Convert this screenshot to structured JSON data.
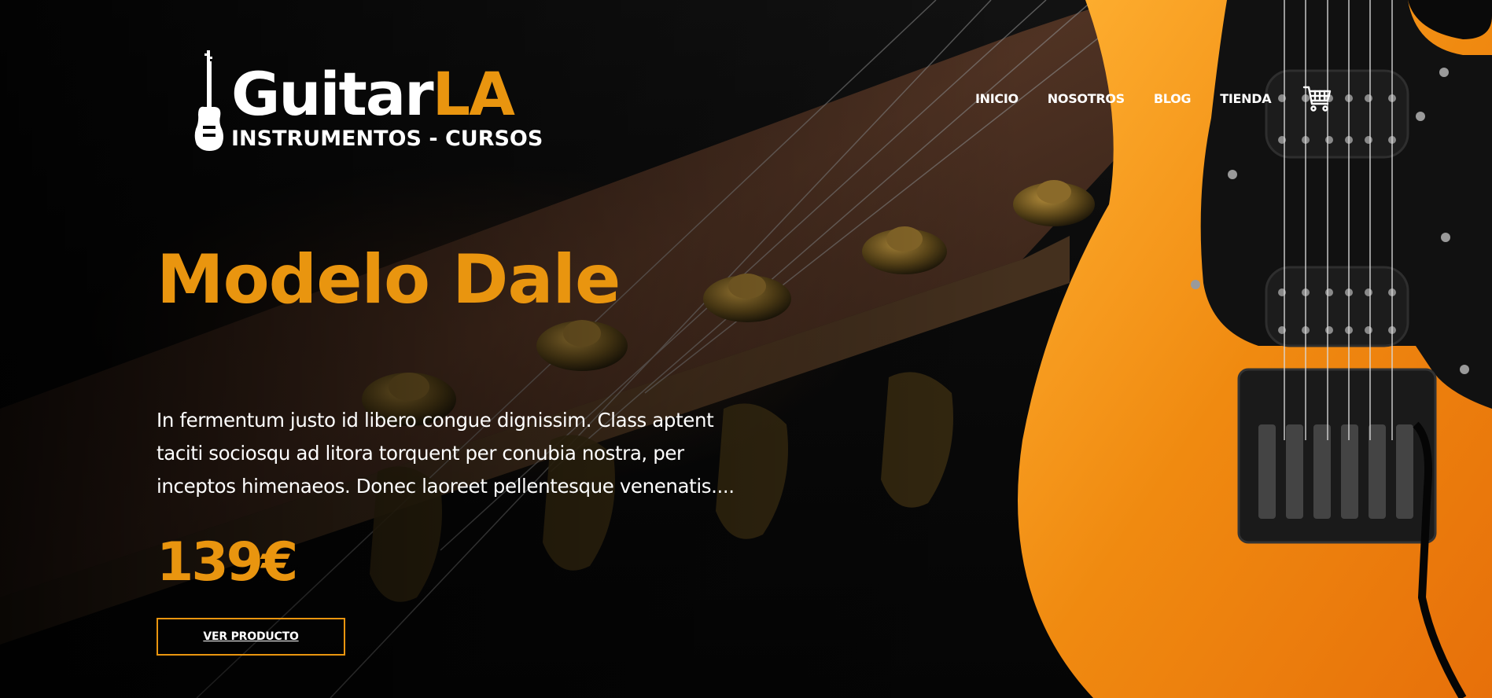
{
  "brand": {
    "name_primary": "Guitar",
    "name_accent": "LA",
    "tagline": "INSTRUMENTOS - CURSOS"
  },
  "nav": {
    "items": [
      {
        "label": "INICIO"
      },
      {
        "label": "NOSOTROS"
      },
      {
        "label": "BLOG"
      },
      {
        "label": "TIENDA"
      }
    ],
    "cart_icon": "cart-icon"
  },
  "hero": {
    "title": "Modelo Dale",
    "description": "In fermentum justo id libero congue dignissim. Class aptent taciti sociosqu ad litora torquent per conubia nostra, per inceptos himenaeos. Donec laoreet pellentesque venenatis....",
    "price": "139€",
    "button_label": "VER PRODUCTO"
  },
  "colors": {
    "accent": "#e9950f",
    "text": "#ffffff",
    "background": "#000000",
    "guitar_body": "#f39a1a"
  }
}
